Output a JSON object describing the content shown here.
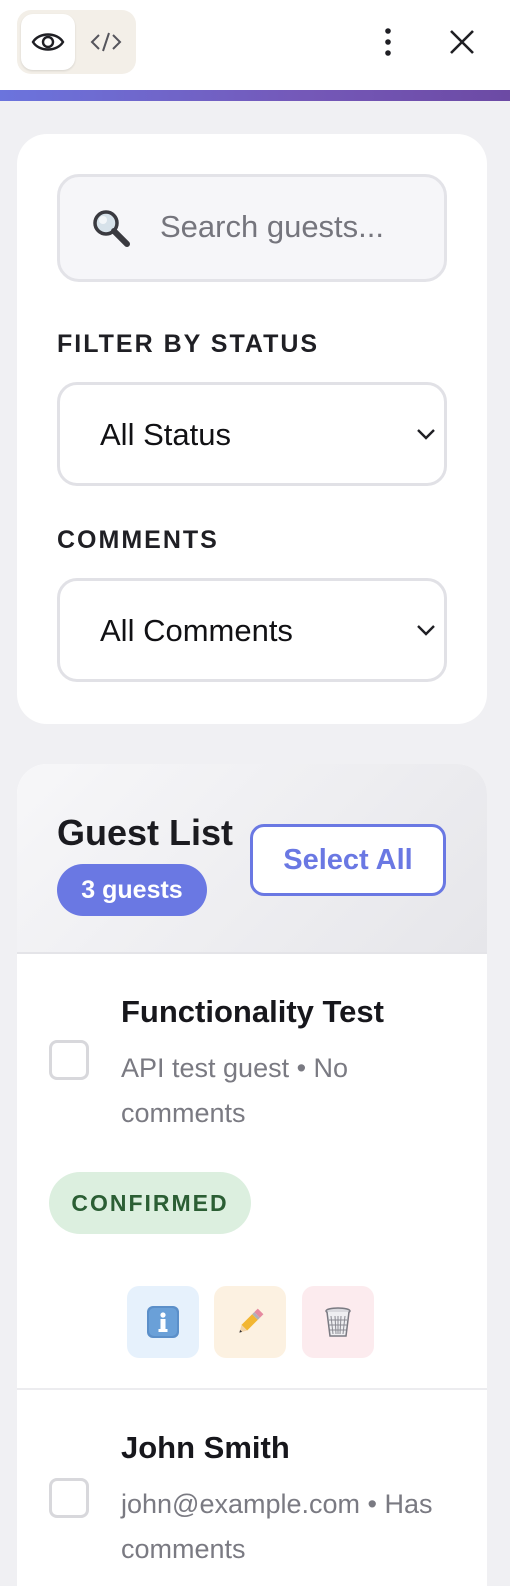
{
  "toolbar": {
    "preview_icon": "eye-icon",
    "code_icon": "code-icon",
    "more_icon": "vertical-dots-icon",
    "close_icon": "close-icon"
  },
  "colors": {
    "accent": "#6a78e3",
    "confirmed_bg": "#dcefdf",
    "confirmed_text": "#2b5e34"
  },
  "filters": {
    "search": {
      "placeholder": "Search guests...",
      "value": "",
      "icon": "magnifier-icon"
    },
    "status": {
      "label": "FILTER BY STATUS",
      "selected": "All Status"
    },
    "comments": {
      "label": "COMMENTS",
      "selected": "All Comments"
    }
  },
  "guest_list": {
    "title": "Guest List",
    "count_label": "3 guests",
    "select_all_label": "Select All",
    "guests": [
      {
        "name": "Functionality Test",
        "meta": "API test guest • No comments",
        "status": "CONFIRMED",
        "actions": [
          "info-icon",
          "pencil-icon",
          "trash-icon"
        ]
      },
      {
        "name": "John Smith",
        "meta": "john@example.com • Has comments"
      }
    ]
  }
}
